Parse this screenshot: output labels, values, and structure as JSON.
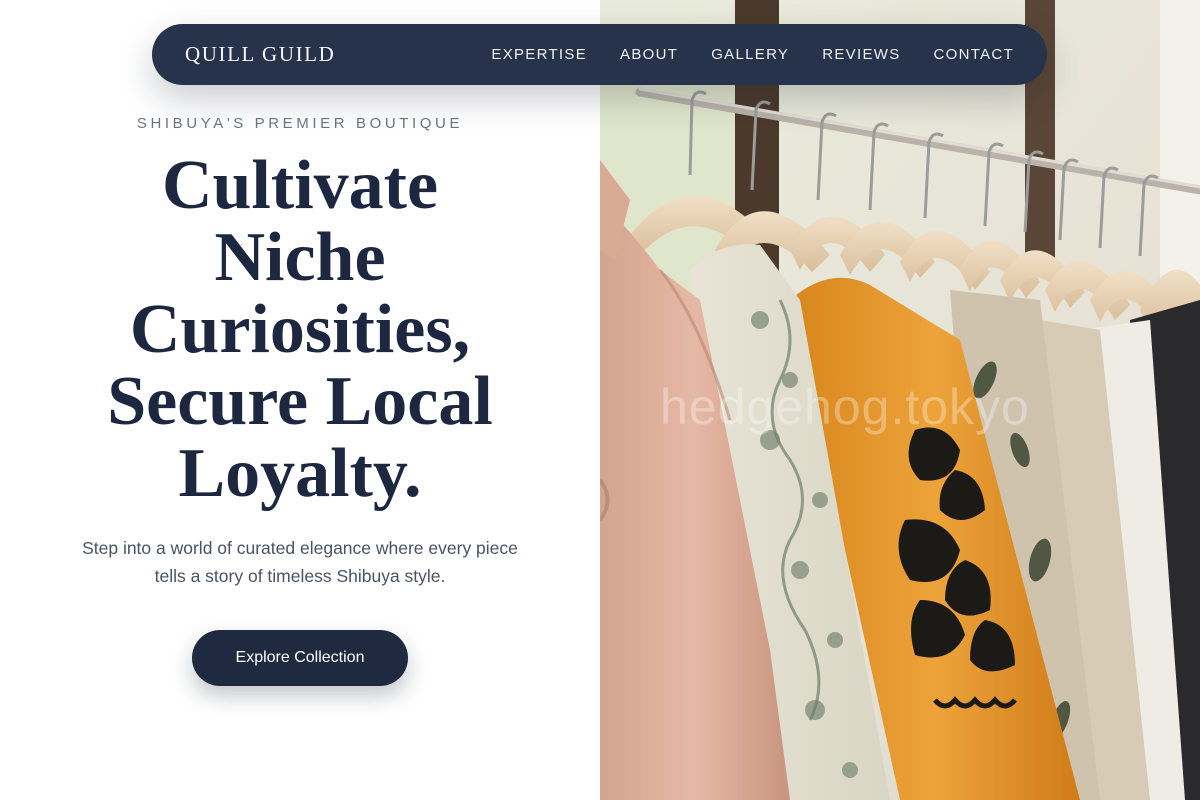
{
  "nav": {
    "brand": "QUILL GUILD",
    "links": [
      "EXPERTISE",
      "ABOUT",
      "GALLERY",
      "REVIEWS",
      "CONTACT"
    ]
  },
  "hero": {
    "eyebrow": "SHIBUYA'S PREMIER BOUTIQUE",
    "headline_lines": [
      "Cultivate",
      "Niche",
      "Curiosities,",
      "Secure Local",
      "Loyalty."
    ],
    "subcopy": "Step into a world of curated elegance where every piece tells a story of timeless Shibuya style.",
    "cta_label": "Explore Collection"
  },
  "photo": {
    "subject": "clothing rack with garments on wooden hangers",
    "watermark": "hedgehog.tokyo"
  },
  "colors": {
    "navy": "#27334a",
    "heading": "#1d2840",
    "body_text": "#4a5364",
    "eyebrow": "#6b7383",
    "garment_orange": "#e59a2c"
  }
}
